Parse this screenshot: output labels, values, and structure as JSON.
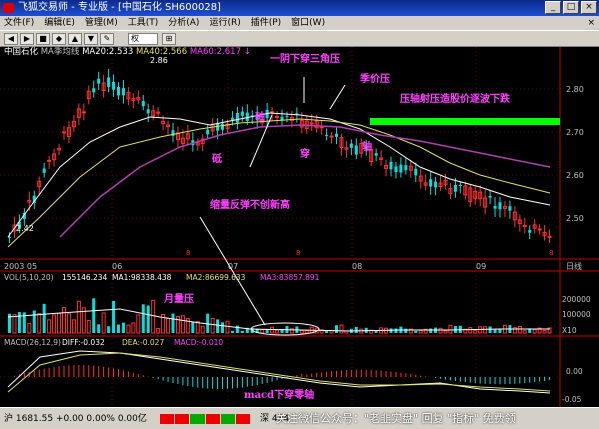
{
  "window": {
    "app_name": "飞狐交易师",
    "edition": "专业版",
    "stock_tab": "[中国石化 SH600028]",
    "title_sep": " - "
  },
  "menu": {
    "items": [
      "文件(F)",
      "编辑(E)",
      "管理(M)",
      "工具(T)",
      "分析(A)",
      "运行(R)",
      "插件(P)",
      "窗口(W)"
    ],
    "close_mark": "×"
  },
  "toolbar": {
    "period_select": "权",
    "buttons": [
      "◀",
      "▶",
      "■",
      "◆",
      "▲",
      "▼",
      "✎",
      "⊞"
    ]
  },
  "main_panel": {
    "stock_name": "中国石化",
    "indicator": "MA季均线",
    "ma20": "MA20:2.533",
    "ma40": "MA40:2.566",
    "ma60": "MA60:2.617",
    "arrow": "↓",
    "high_label": "2.86",
    "low_label": "2.42",
    "y_ticks": [
      "2.80",
      "2.70",
      "2.60",
      "2.50"
    ],
    "x_ticks": [
      "2003 05",
      "06",
      "07",
      "08",
      "09",
      "日线"
    ],
    "x_ticks_cn": [
      "8",
      "8",
      "8"
    ]
  },
  "vol_panel": {
    "label": "VOL(5,10,20)",
    "vol": "155146.234",
    "ma1": "MA1:98338.438",
    "ma2": "MA2:86699.633",
    "ma3": "MA3:83857.891",
    "y_ticks": [
      "200000",
      "100000",
      "X10"
    ]
  },
  "macd_panel": {
    "label": "MACD(26,12,9)",
    "diff": "DIFF:-0.032",
    "dea": "DEA:-0.027",
    "macd": "MACD:-0.010",
    "y_ticks": [
      "0.00",
      "-0.05"
    ]
  },
  "annotations": {
    "one_yin_three": "一阴下穿三角压",
    "season_pressure": "季价压",
    "axis_pressure": "压轴射压造股价逐波下跌",
    "zhou_left": "轴",
    "di": "砥",
    "chuan": "穿",
    "zhou_right": "轴",
    "shrink_rebound": "缩量反弹不创新高",
    "month_volume": "月量压",
    "macd_cross": "macd下穿零轴"
  },
  "status": {
    "sh_index": "沪 1681.55 +0.00 0.00% 0.00亿",
    "sz_prefix": "深 434"
  },
  "watermark": "关注微信公众号：\"老韭实盘\" 回复 \"指标\" 免费领",
  "chart_data": {
    "type": "candlestick",
    "x_range": [
      "2003-05",
      "2003-09"
    ],
    "ylim": [
      2.42,
      2.86
    ],
    "series": [
      {
        "name": "MA20",
        "value": 2.533
      },
      {
        "name": "MA40",
        "value": 2.566
      },
      {
        "name": "MA60",
        "value": 2.617
      }
    ],
    "support_band_level": 2.72
  },
  "colors": {
    "up": "#ff3030",
    "down": "#00e0e0",
    "ma_white": "#ffffff",
    "ma_yellow": "#e0e060",
    "ma_purple": "#b040b0",
    "band": "#00ff00",
    "annotation": "#ff40ff",
    "axis_red": "#c00000"
  }
}
